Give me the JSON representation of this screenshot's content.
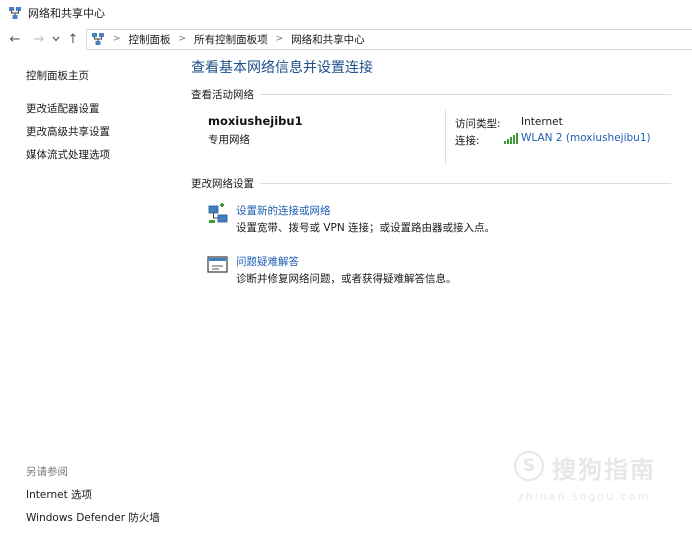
{
  "window": {
    "title": "网络和共享中心",
    "icon": "network-center-icon"
  },
  "nav": {
    "back_glyph": "←",
    "forward_glyph": "→",
    "recent_glyph": "⌄",
    "up_glyph": "↑",
    "separator": ">",
    "breadcrumbs": [
      "控制面板",
      "所有控制面板项",
      "网络和共享中心"
    ]
  },
  "sidebar": {
    "items": [
      {
        "label": "控制面板主页"
      },
      {
        "label": "更改适配器设置"
      },
      {
        "label": "更改高级共享设置"
      },
      {
        "label": "媒体流式处理选项"
      }
    ]
  },
  "see_also": {
    "title": "另请参阅",
    "items": [
      {
        "label": "Internet 选项"
      },
      {
        "label": "Windows Defender 防火墙"
      }
    ]
  },
  "main": {
    "title": "查看基本网络信息并设置连接",
    "active_section": "查看活动网络",
    "network": {
      "name": "moxiushejibu1",
      "type": "专用网络",
      "access_label": "访问类型:",
      "access_value": "Internet",
      "connection_label": "连接:",
      "connection_value": "WLAN 2 (moxiushejibu1)",
      "connection_icon": "wifi-signal-icon"
    },
    "change_section": "更改网络设置",
    "tasks": [
      {
        "link": "设置新的连接或网络",
        "desc": "设置宽带、拨号或 VPN 连接；或设置路由器或接入点。",
        "icon": "new-connection-icon"
      },
      {
        "link": "问题疑难解答",
        "desc": "诊断并修复网络问题，或者获得疑难解答信息。",
        "icon": "troubleshoot-icon"
      }
    ]
  },
  "watermark": {
    "mark": "S",
    "text": "搜狗指南",
    "url": "zhinan.sogou.com"
  },
  "colors": {
    "title_blue": "#1e4e8c",
    "link_blue": "#1e5fb3",
    "wifi_green": "#3c9c34"
  }
}
